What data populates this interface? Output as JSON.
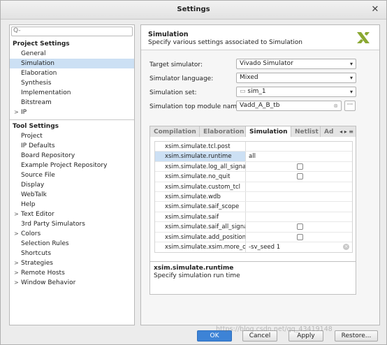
{
  "window": {
    "title": "Settings",
    "close": "✕"
  },
  "search": {
    "icon": "Q-",
    "placeholder": ""
  },
  "left": {
    "project_section": "Project Settings",
    "project_items": [
      {
        "label": "General",
        "arrow": ""
      },
      {
        "label": "Simulation",
        "arrow": "",
        "selected": true
      },
      {
        "label": "Elaboration",
        "arrow": ""
      },
      {
        "label": "Synthesis",
        "arrow": ""
      },
      {
        "label": "Implementation",
        "arrow": ""
      },
      {
        "label": "Bitstream",
        "arrow": ""
      },
      {
        "label": "IP",
        "arrow": ">"
      }
    ],
    "tool_section": "Tool Settings",
    "tool_items": [
      {
        "label": "Project",
        "arrow": ""
      },
      {
        "label": "IP Defaults",
        "arrow": ""
      },
      {
        "label": "Board Repository",
        "arrow": ""
      },
      {
        "label": "Example Project Repository",
        "arrow": ""
      },
      {
        "label": "Source File",
        "arrow": ""
      },
      {
        "label": "Display",
        "arrow": ""
      },
      {
        "label": "WebTalk",
        "arrow": ""
      },
      {
        "label": "Help",
        "arrow": ""
      },
      {
        "label": "Text Editor",
        "arrow": ">"
      },
      {
        "label": "3rd Party Simulators",
        "arrow": ""
      },
      {
        "label": "Colors",
        "arrow": ">"
      },
      {
        "label": "Selection Rules",
        "arrow": ""
      },
      {
        "label": "Shortcuts",
        "arrow": ""
      },
      {
        "label": "Strategies",
        "arrow": ">"
      },
      {
        "label": "Remote Hosts",
        "arrow": ">"
      },
      {
        "label": "Window Behavior",
        "arrow": ">"
      }
    ]
  },
  "panel": {
    "title": "Simulation",
    "subtitle": "Specify various settings associated to Simulation",
    "fields": {
      "target_label": "Target simulator:",
      "target_value": "Vivado Simulator",
      "language_label": "Simulator language:",
      "language_value": "Mixed",
      "set_label": "Simulation set:",
      "set_value": "sim_1",
      "top_label": "Simulation top module name:",
      "top_value": "Vadd_A_B_tb",
      "more": "···"
    },
    "tabs": [
      "Compilation",
      "Elaboration",
      "Simulation",
      "Netlist",
      "Ad"
    ],
    "tab_nav": "◂ ▸ ≡",
    "properties": [
      {
        "key": "xsim.simulate.tcl.post",
        "value": "",
        "checkbox": false
      },
      {
        "key": "xsim.simulate.runtime",
        "value": "all",
        "checkbox": false,
        "selected": true
      },
      {
        "key": "xsim.simulate.log_all_signals",
        "value": "",
        "checkbox": true
      },
      {
        "key": "xsim.simulate.no_quit",
        "value": "",
        "checkbox": true
      },
      {
        "key": "xsim.simulate.custom_tcl",
        "value": "",
        "checkbox": false
      },
      {
        "key": "xsim.simulate.wdb",
        "value": "",
        "checkbox": false
      },
      {
        "key": "xsim.simulate.saif_scope",
        "value": "",
        "checkbox": false
      },
      {
        "key": "xsim.simulate.saif",
        "value": "",
        "checkbox": false
      },
      {
        "key": "xsim.simulate.saif_all_signals",
        "value": "",
        "checkbox": true
      },
      {
        "key": "xsim.simulate.add_positional",
        "value": "",
        "checkbox": true
      },
      {
        "key": "xsim.simulate.xsim.more_o...",
        "value": "-sv_seed 1",
        "checkbox": false,
        "clear": true
      }
    ],
    "description": {
      "title": "xsim.simulate.runtime",
      "text": "Specify simulation run time"
    }
  },
  "buttons": {
    "ok": "OK",
    "cancel": "Cancel",
    "apply": "Apply",
    "restore": "Restore..."
  },
  "watermark": "https://blog.csdn.net/qq_43419148",
  "colors": {
    "accent": "#3d83d6",
    "selection": "#cce0f4",
    "logo": "#8aa832"
  }
}
